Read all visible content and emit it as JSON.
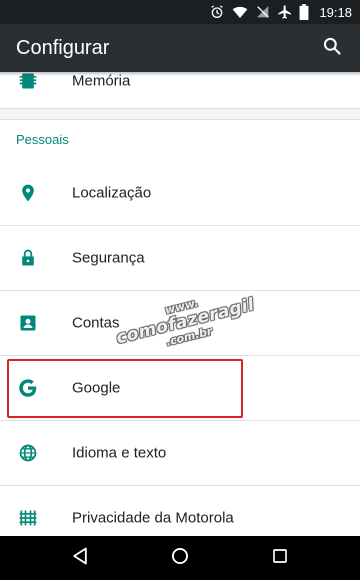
{
  "status_bar": {
    "time": "19:18",
    "icons": [
      "alarm-icon",
      "wifi-icon",
      "no-sim-icon",
      "airplane-icon",
      "battery-icon"
    ]
  },
  "app_bar": {
    "title": "Configurar",
    "search_icon": "search-icon"
  },
  "list": {
    "partial_item": {
      "label": "Memória",
      "icon": "memory-icon"
    },
    "section_header": "Pessoais",
    "items": [
      {
        "label": "Localização",
        "icon": "location-icon"
      },
      {
        "label": "Segurança",
        "icon": "lock-icon"
      },
      {
        "label": "Contas",
        "icon": "account-icon"
      },
      {
        "label": "Google",
        "icon": "google-icon",
        "highlighted": true
      },
      {
        "label": "Idioma e texto",
        "icon": "globe-icon"
      },
      {
        "label": "Privacidade da Motorola",
        "icon": "motorola-privacy-icon"
      }
    ]
  },
  "watermark": {
    "line1": "www.",
    "line2": "comofazeragil",
    "line3": ".com.br"
  },
  "nav_bar": {
    "buttons": [
      "back-icon",
      "home-icon",
      "recents-icon"
    ]
  },
  "colors": {
    "accent": "#00897b",
    "app_bar": "#2a2f33",
    "status_bar": "#1c1f22",
    "highlight": "#d9232a"
  }
}
